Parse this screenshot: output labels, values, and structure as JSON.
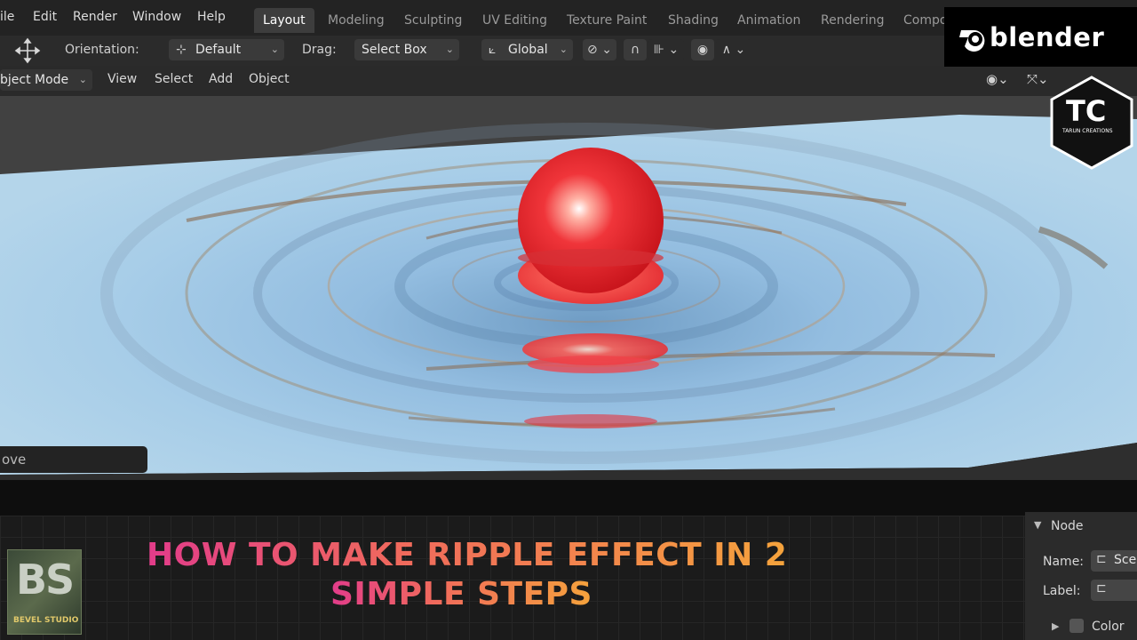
{
  "menu": [
    "ile",
    "Edit",
    "Render",
    "Window",
    "Help"
  ],
  "workspace_tabs": [
    "Layout",
    "Modeling",
    "Sculpting",
    "UV Editing",
    "Texture Paint",
    "Shading",
    "Animation",
    "Rendering",
    "Compo"
  ],
  "active_tab": "Layout",
  "tool_header": {
    "orientation_label": "Orientation:",
    "orientation_value": "Default",
    "drag_label": "Drag:",
    "drag_value": "Select Box",
    "transform_orientation": "Global"
  },
  "viewport_header": {
    "mode": "bject Mode",
    "menus": [
      "View",
      "Select",
      "Add",
      "Object"
    ]
  },
  "operator_panel": "ove",
  "node_panel": {
    "header": "Node",
    "name_label": "Name:",
    "name_value": "Sce",
    "label_label": "Label:",
    "color_label": "Color"
  },
  "brand": {
    "blender_text": "blender",
    "tc_text": "TC",
    "tc_subtext": "TARUN CREATIONS",
    "bs_text": "BS",
    "bs_subtext": "BEVEL STUDIO"
  },
  "title": {
    "line1": "HOW TO MAKE RIPPLE EFFECT IN 2",
    "line2": "SIMPLE STEPS"
  },
  "colors": {
    "sphere": "#e8262a",
    "water": "#9cc3e0",
    "title_start": "#e23c8a",
    "title_end": "#f5a33c"
  }
}
